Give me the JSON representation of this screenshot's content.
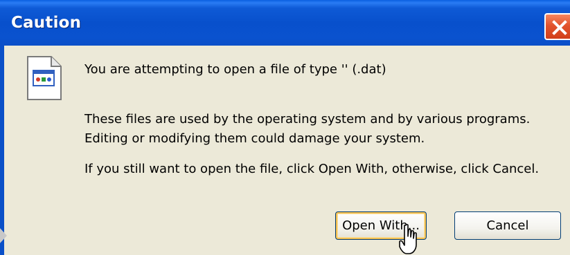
{
  "window": {
    "title": "Caution"
  },
  "message": {
    "line1": "You are attempting to open a file of type '' (.dat)",
    "line2": "These files are used by the operating system and by various programs. Editing or modifying them could damage your system.",
    "line3": "If you still want to open the file, click Open With, otherwise, click Cancel."
  },
  "buttons": {
    "open_with": "Open With...",
    "cancel": "Cancel"
  },
  "icons": {
    "close": "close-icon",
    "file": "file-icon",
    "cursor": "mouse-cursor-icon"
  },
  "colors": {
    "titlebar": "#0850cc",
    "body": "#ece9d8",
    "close": "#e2532d",
    "focus": "#f4c052"
  }
}
